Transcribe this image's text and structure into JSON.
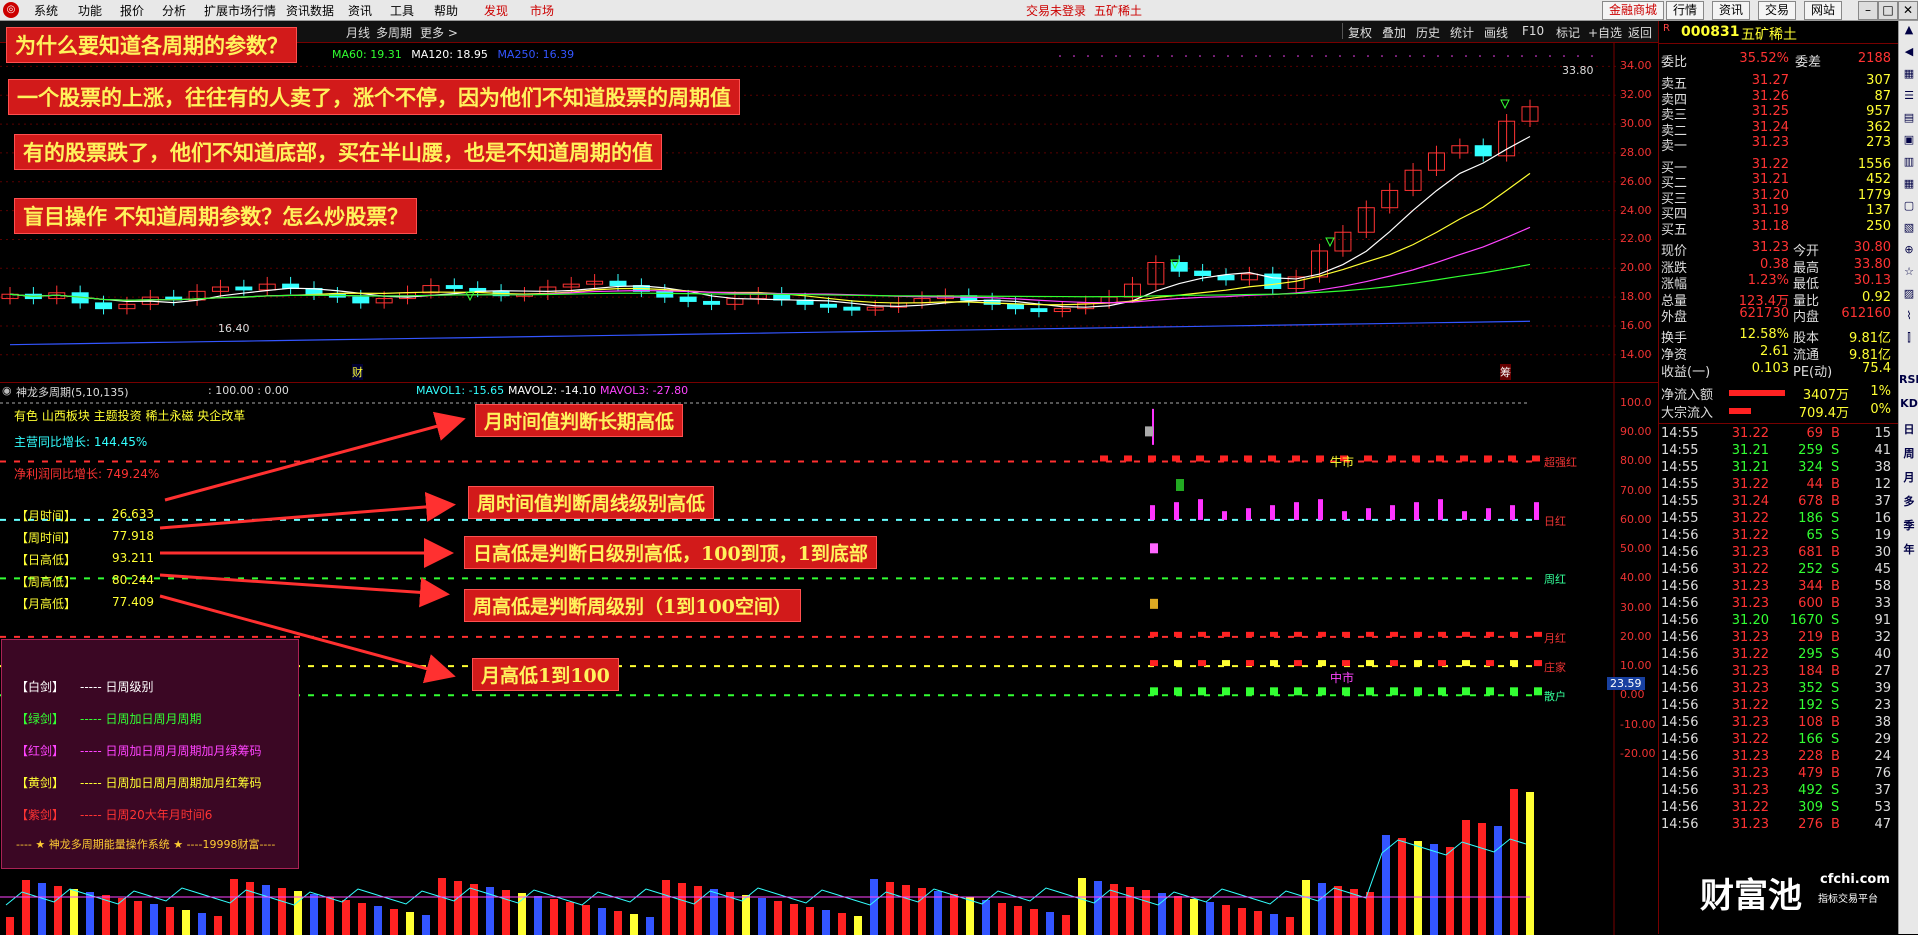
{
  "menu": {
    "items": [
      "系统",
      "功能",
      "报价",
      "分析",
      "扩展市场行情",
      "资讯数据",
      "资讯",
      "工具",
      "帮助"
    ],
    "discover": "发现",
    "market": "市场",
    "login_status": "交易未登录",
    "stock_name_top": "五矿稀土",
    "right_buttons": [
      "金融商城",
      "行情",
      "资讯",
      "交易",
      "网站"
    ]
  },
  "toolbar": {
    "left_items": [
      "月线",
      "多周期",
      "更多 >"
    ],
    "right_items": [
      "复权",
      "叠加",
      "历史",
      "统计",
      "画线",
      "F10",
      "标记",
      "+自选",
      "返回"
    ]
  },
  "main_chart": {
    "ma_labels": [
      {
        "text": "MA60: 19.31",
        "color": "#30ff30"
      },
      {
        "text": "MA120: 18.95",
        "color": "#ffffff"
      },
      {
        "text": "MA250: 16.39",
        "color": "#3355ff"
      }
    ],
    "price_ticks": [
      "34.00",
      "32.00",
      "30.00",
      "28.00",
      "26.00",
      "24.00",
      "22.00",
      "20.00",
      "18.00",
      "16.00",
      "14.00"
    ],
    "high_label": "33.80",
    "low_label": "16.40",
    "cai_label": "财",
    "chou_label": "筹"
  },
  "callouts": {
    "c1": "为什么要知道各周期的参数？",
    "c2": "一个股票的上涨，往往有的人卖了，涨个不停，因为他们不知道股票的周期值",
    "c3": "有的股票跌了，他们不知道底部，买在半山腰，也是不知道周期的值",
    "c4": "盲目操作  不知道周期参数？怎么炒股票？",
    "c5": "月时间值判断长期高低",
    "c6": "周时间值判断周线级别高低",
    "c7": "日高低是判断日级别高低，100到顶，1到底部",
    "c8": "周高低是判断周级别（1到100空间）",
    "c9": "月高低1到100"
  },
  "indicator": {
    "title": "神龙多周期(5,10,135)",
    "title_vals": ": 100.00  : 0.00",
    "mavol1": "MAVOL1: -15.65",
    "mavol2": "MAVOL2: -14.10",
    "mavol3": "MAVOL3: -27.80",
    "sector": "有色 山西板块 主题投资 稀土永磁 央企改革",
    "main_growth": "主营同比增长: 144.45%",
    "net_growth": "净利润同比增长: 749.24%",
    "rows": [
      {
        "label": "【月时间】",
        "value": "26.633"
      },
      {
        "label": "【周时间】",
        "value": "77.918"
      },
      {
        "label": "【日高低】",
        "value": "93.211"
      },
      {
        "label": "【周高低】",
        "value": "80.244"
      },
      {
        "label": "【月高低】",
        "value": "77.409"
      }
    ],
    "ticks": [
      "100.0",
      "90.00",
      "80.00",
      "70.00",
      "60.00",
      "50.00",
      "40.00",
      "30.00",
      "20.00",
      "10.00",
      "0.00",
      "-10.00",
      "-20.00"
    ],
    "current_value": "23.59",
    "line_labels": [
      "超强红",
      "日红",
      "周红",
      "月红",
      "庄家",
      "散户"
    ],
    "niu": "牛市",
    "zhong": "中市"
  },
  "legend": {
    "items": [
      {
        "name": "【白剑】",
        "desc": "----- 日周级别",
        "color": "#ffffff"
      },
      {
        "name": "【绿剑】",
        "desc": "----- 日周加日周月周期",
        "color": "#33ff33"
      },
      {
        "name": "【红剑】",
        "desc": "----- 日周加日周月周期加月绿筹码",
        "color": "#ff44ff"
      },
      {
        "name": "【黄剑】",
        "desc": "----- 日周加日周月周期加月红筹码",
        "color": "#ffff33"
      },
      {
        "name": "【紫剑】",
        "desc": "----- 日周20大年月时间6",
        "color": "#ff3333"
      }
    ],
    "footer": "---- ★ 神龙多周期能量操作系统 ★ ----19998财富----"
  },
  "quote": {
    "code": "000831",
    "name": "五矿稀土",
    "webi_label": "委比",
    "webi": "35.52%",
    "weicha_label": "委差",
    "weicha": "2188",
    "asks": [
      {
        "label": "卖五",
        "price": "31.27",
        "vol": "307"
      },
      {
        "label": "卖四",
        "price": "31.26",
        "vol": "87"
      },
      {
        "label": "卖三",
        "price": "31.25",
        "vol": "957"
      },
      {
        "label": "卖二",
        "price": "31.24",
        "vol": "362"
      },
      {
        "label": "卖一",
        "price": "31.23",
        "vol": "273"
      }
    ],
    "bids": [
      {
        "label": "买一",
        "price": "31.22",
        "vol": "1556"
      },
      {
        "label": "买二",
        "price": "31.21",
        "vol": "452"
      },
      {
        "label": "买三",
        "price": "31.20",
        "vol": "1779"
      },
      {
        "label": "买四",
        "price": "31.19",
        "vol": "137"
      },
      {
        "label": "买五",
        "price": "31.18",
        "vol": "250"
      }
    ],
    "stats": [
      {
        "l1": "现价",
        "v1": "31.23",
        "l2": "今开",
        "v2": "30.80"
      },
      {
        "l1": "涨跌",
        "v1": "0.38",
        "l2": "最高",
        "v2": "33.80"
      },
      {
        "l1": "涨幅",
        "v1": "1.23%",
        "l2": "最低",
        "v2": "30.13"
      },
      {
        "l1": "总量",
        "v1": "123.4万",
        "l2": "量比",
        "v2": "0.92"
      },
      {
        "l1": "外盘",
        "v1": "621730",
        "l2": "内盘",
        "v2": "612160"
      }
    ],
    "stats2": [
      {
        "l1": "换手",
        "v1": "12.58%",
        "l2": "股本",
        "v2": "9.81亿"
      },
      {
        "l1": "净资",
        "v1": "2.61",
        "l2": "流通",
        "v2": "9.81亿"
      },
      {
        "l1": "收益(一)",
        "v1": "0.103",
        "l2": "PE(动)",
        "v2": "75.4"
      }
    ],
    "flows": [
      {
        "label": "净流入额",
        "value": "3407万",
        "pct": "1%"
      },
      {
        "label": "大宗流入",
        "value": "709.4万",
        "pct": "0%"
      }
    ],
    "ticks": [
      {
        "t": "14:55",
        "p": "31.22",
        "v": "69",
        "d": "B",
        "n": "15"
      },
      {
        "t": "14:55",
        "p": "31.21",
        "v": "259",
        "d": "S",
        "n": "41"
      },
      {
        "t": "14:55",
        "p": "31.21",
        "v": "324",
        "d": "S",
        "n": "38"
      },
      {
        "t": "14:55",
        "p": "31.22",
        "v": "44",
        "d": "B",
        "n": "12"
      },
      {
        "t": "14:55",
        "p": "31.24",
        "v": "678",
        "d": "B",
        "n": "37"
      },
      {
        "t": "14:55",
        "p": "31.22",
        "v": "186",
        "d": "S",
        "n": "16"
      },
      {
        "t": "14:56",
        "p": "31.22",
        "v": "65",
        "d": "S",
        "n": "19"
      },
      {
        "t": "14:56",
        "p": "31.23",
        "v": "681",
        "d": "B",
        "n": "30"
      },
      {
        "t": "14:56",
        "p": "31.22",
        "v": "252",
        "d": "S",
        "n": "45"
      },
      {
        "t": "14:56",
        "p": "31.23",
        "v": "344",
        "d": "B",
        "n": "58"
      },
      {
        "t": "14:56",
        "p": "31.23",
        "v": "600",
        "d": "B",
        "n": "33"
      },
      {
        "t": "14:56",
        "p": "31.20",
        "v": "1670",
        "d": "S",
        "n": "91"
      },
      {
        "t": "14:56",
        "p": "31.23",
        "v": "219",
        "d": "B",
        "n": "32"
      },
      {
        "t": "14:56",
        "p": "31.22",
        "v": "295",
        "d": "S",
        "n": "40"
      },
      {
        "t": "14:56",
        "p": "31.23",
        "v": "184",
        "d": "B",
        "n": "27"
      },
      {
        "t": "14:56",
        "p": "31.23",
        "v": "352",
        "d": "S",
        "n": "39"
      },
      {
        "t": "14:56",
        "p": "31.22",
        "v": "192",
        "d": "S",
        "n": "23"
      },
      {
        "t": "14:56",
        "p": "31.23",
        "v": "108",
        "d": "B",
        "n": "38"
      },
      {
        "t": "14:56",
        "p": "31.22",
        "v": "166",
        "d": "S",
        "n": "29"
      },
      {
        "t": "14:56",
        "p": "31.23",
        "v": "228",
        "d": "B",
        "n": "24"
      },
      {
        "t": "14:56",
        "p": "31.23",
        "v": "479",
        "d": "B",
        "n": "76"
      },
      {
        "t": "14:56",
        "p": "31.23",
        "v": "492",
        "d": "S",
        "n": "37"
      },
      {
        "t": "14:56",
        "p": "31.22",
        "v": "309",
        "d": "S",
        "n": "53"
      },
      {
        "t": "14:56",
        "p": "31.23",
        "v": "276",
        "d": "B",
        "n": "47"
      }
    ]
  },
  "side_tabs": [
    "RSI",
    "KD",
    "日",
    "周",
    "月",
    "多",
    "季",
    "年"
  ],
  "watermark": {
    "big": "财富池",
    "site": "cfchi.com",
    "sub": "指标交易平台"
  }
}
